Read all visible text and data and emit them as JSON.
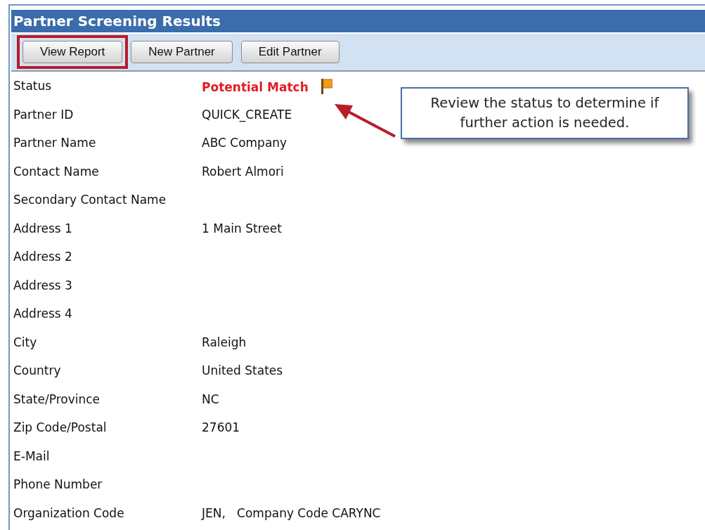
{
  "panel": {
    "title": "Partner Screening Results"
  },
  "toolbar": {
    "buttons": [
      {
        "label": "View Report",
        "highlighted": true
      },
      {
        "label": "New Partner",
        "highlighted": false
      },
      {
        "label": "Edit Partner",
        "highlighted": false
      }
    ]
  },
  "fields": [
    {
      "label": "Status",
      "value": "Potential Match",
      "kind": "status"
    },
    {
      "label": "Partner ID",
      "value": "QUICK_CREATE",
      "kind": "text"
    },
    {
      "label": "Partner Name",
      "value": "ABC Company",
      "kind": "text"
    },
    {
      "label": "Contact Name",
      "value": "Robert Almori",
      "kind": "text"
    },
    {
      "label": "Secondary Contact Name"
    },
    {
      "label": "Address 1",
      "value": "1 Main Street",
      "kind": "text"
    },
    {
      "label": "Address 2"
    },
    {
      "label": "Address 3"
    },
    {
      "label": "Address 4"
    },
    {
      "label": "City",
      "value": "Raleigh",
      "kind": "text"
    },
    {
      "label": "Country",
      "value": "United States",
      "kind": "text"
    },
    {
      "label": "State/Province",
      "value": "NC",
      "kind": "text"
    },
    {
      "label": "Zip Code/Postal",
      "value": "27601",
      "kind": "text"
    },
    {
      "label": "E-Mail"
    },
    {
      "label": "Phone Number"
    },
    {
      "label": "Organization Code",
      "value": "JEN,   Company Code CARYNC",
      "kind": "text"
    }
  ],
  "callout": {
    "text": "Review the status to determine if further action is needed."
  }
}
